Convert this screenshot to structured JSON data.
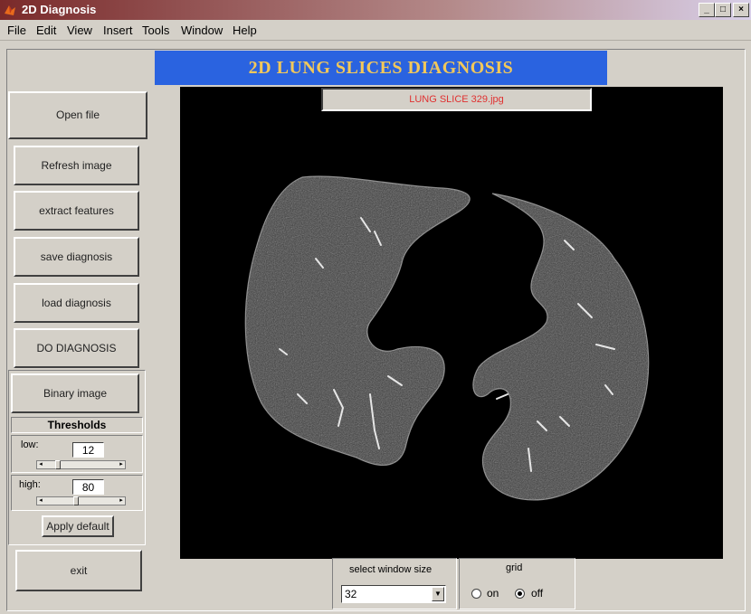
{
  "window": {
    "title": "2D Diagnosis",
    "min": "_",
    "max": "□",
    "close": "×"
  },
  "menu": [
    "File",
    "Edit",
    "View",
    "Insert",
    "Tools",
    "Window",
    "Help"
  ],
  "banner": "2D LUNG SLICES DIAGNOSIS",
  "slice_label": "LUNG SLICE 329.jpg",
  "buttons": {
    "open_file": "Open file",
    "refresh_image": "Refresh image",
    "extract_features": "extract features",
    "save_diagnosis": "save diagnosis",
    "load_diagnosis": "load diagnosis",
    "do_diagnosis": "DO DIAGNOSIS",
    "binary_image": "Binary image",
    "apply_default": "Apply default",
    "exit": "exit"
  },
  "thresholds": {
    "title": "Thresholds",
    "low_label": "low:",
    "low_value": "12",
    "high_label": "high:",
    "high_value": "80"
  },
  "window_size": {
    "label": "select window size",
    "selected": "32"
  },
  "grid": {
    "label": "grid",
    "on_label": "on",
    "off_label": "off",
    "selected": "off"
  }
}
